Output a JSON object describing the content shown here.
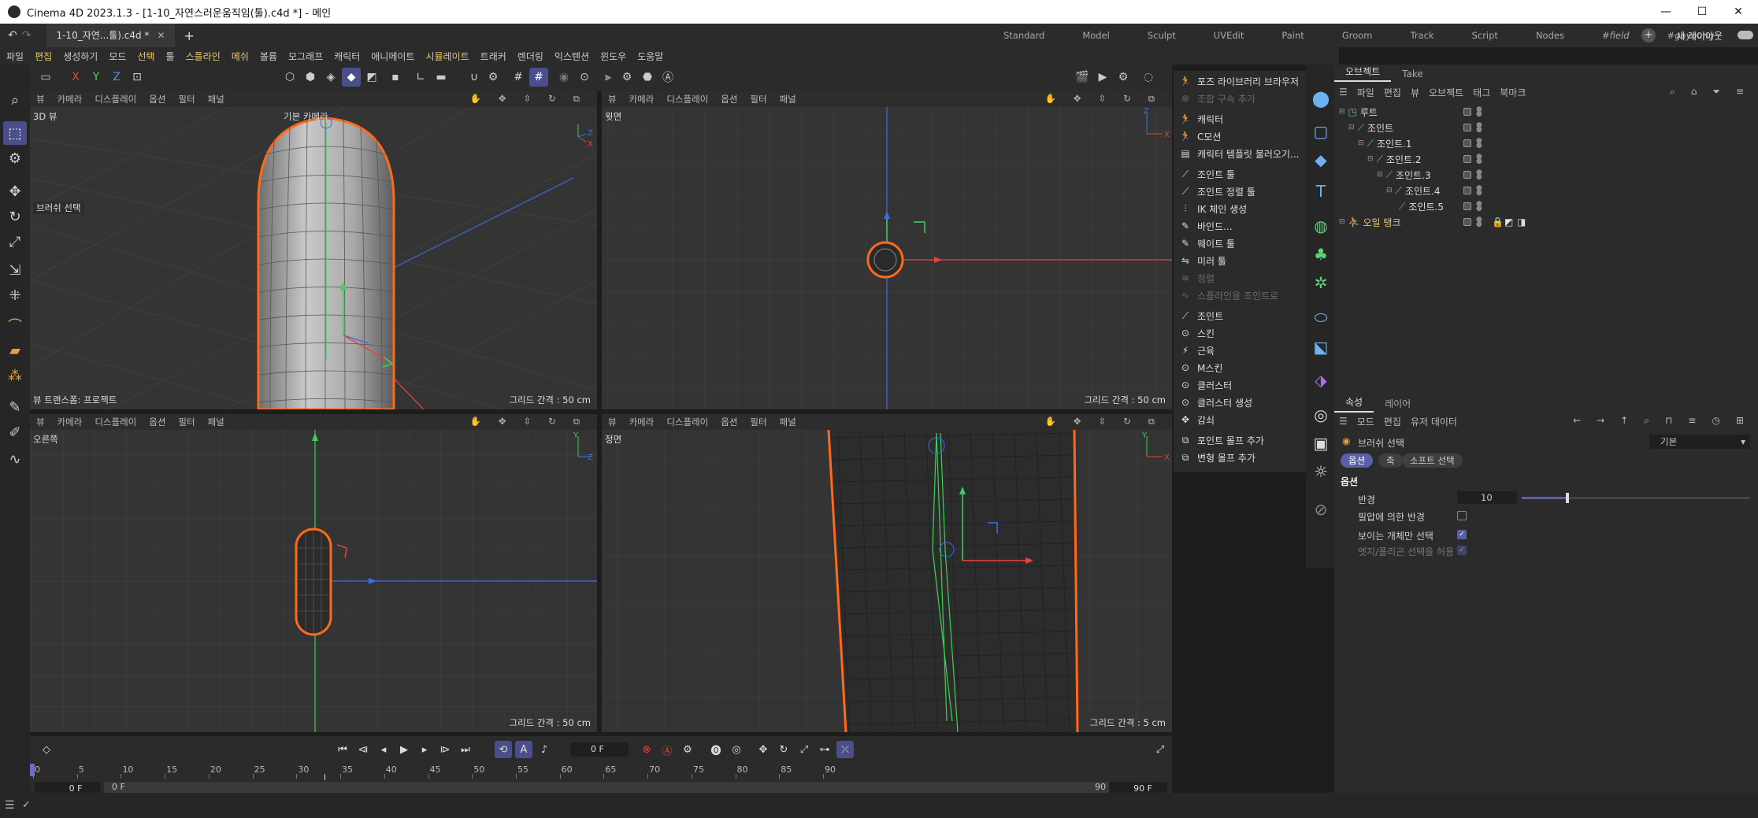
{
  "window": {
    "title": "Cinema 4D 2023.1.3 - [1-10_자연스러운움직임(툴).c4d *] - 메인",
    "minimize": "—",
    "maximize": "☐",
    "close": "✕"
  },
  "file_tab": {
    "label": "1-10_자연...툴).c4d *",
    "close": "✕",
    "add": "+"
  },
  "layouts": [
    "Standard",
    "Model",
    "Sculpt",
    "UVEdit",
    "Paint",
    "Groom",
    "Track",
    "Script",
    "Nodes",
    "#field",
    "#gayoung"
  ],
  "new_layout": "새 레이아웃",
  "menu": [
    "파일",
    "편집",
    "생성하기",
    "모드",
    "선택",
    "툴",
    "스플라인",
    "메쉬",
    "볼륨",
    "모그래프",
    "캐릭터",
    "애니메이트",
    "시뮬레이트",
    "트래커",
    "렌더링",
    "익스텐션",
    "윈도우",
    "도움말"
  ],
  "axis_buttons": [
    "X",
    "Y",
    "Z"
  ],
  "viewports": {
    "tl": {
      "menu": [
        "뷰",
        "카메라",
        "디스플레이",
        "옵션",
        "필터",
        "패널"
      ],
      "name": "3D 뷰",
      "camera": "기본 카메라",
      "grid": "그리드 간격 : 50 cm",
      "transform": "뷰 트랜스폼: 프로젝트",
      "tool_hint": "브러쉬 선택"
    },
    "tr": {
      "menu": [
        "뷰",
        "카메라",
        "디스플레이",
        "옵션",
        "필터",
        "패널"
      ],
      "name": "윗면",
      "grid": "그리드 간격 : 50 cm"
    },
    "bl": {
      "menu": [
        "뷰",
        "카메라",
        "디스플레이",
        "옵션",
        "필터",
        "패널"
      ],
      "name": "오른쪽",
      "grid": "그리드 간격 : 50 cm"
    },
    "br": {
      "menu": [
        "뷰",
        "카메라",
        "디스플레이",
        "옵션",
        "필터",
        "패널"
      ],
      "name": "정면",
      "grid": "그리드 간격 : 5 cm"
    }
  },
  "character_menu": [
    {
      "label": "포즈 라이브러리 브라우저",
      "dim": false
    },
    {
      "label": "조합 구속 추가",
      "dim": true
    },
    {
      "label": "캐릭터",
      "dim": false
    },
    {
      "label": "C모션",
      "dim": false
    },
    {
      "label": "캐릭터 템플릿 불러오기...",
      "dim": false
    },
    {
      "label": "조인트 툴",
      "dim": false
    },
    {
      "label": "조인트 정렬 툴",
      "dim": false
    },
    {
      "label": "IK 체인 생성",
      "dim": false
    },
    {
      "label": "바인드...",
      "dim": false
    },
    {
      "label": "웨이트 툴",
      "dim": false
    },
    {
      "label": "미러 툴",
      "dim": false
    },
    {
      "label": "정렬",
      "dim": true
    },
    {
      "label": "스플라인을 조인트로",
      "dim": true
    },
    {
      "label": "조인트",
      "dim": false
    },
    {
      "label": "스킨",
      "dim": false
    },
    {
      "label": "근육",
      "dim": false
    },
    {
      "label": "M스킨",
      "dim": false
    },
    {
      "label": "클러스터",
      "dim": false
    },
    {
      "label": "클러스터 생성",
      "dim": false
    },
    {
      "label": "감쇠",
      "dim": false
    },
    {
      "label": "포인트 몰프 추가",
      "dim": false
    },
    {
      "label": "변형 몰프 추가",
      "dim": false
    }
  ],
  "object_panel": {
    "tabs": [
      "오브젝트",
      "Take"
    ],
    "menu": [
      "파일",
      "편집",
      "뷰",
      "오브젝트",
      "태그",
      "북마크"
    ],
    "tree": [
      {
        "name": "루트",
        "depth": 0
      },
      {
        "name": "조인트",
        "depth": 1
      },
      {
        "name": "조인트.1",
        "depth": 2
      },
      {
        "name": "조인트.2",
        "depth": 3
      },
      {
        "name": "조인트.3",
        "depth": 4
      },
      {
        "name": "조인트.4",
        "depth": 5
      },
      {
        "name": "조인트.5",
        "depth": 6
      },
      {
        "name": "오일 탱크",
        "depth": 0
      }
    ]
  },
  "attributes": {
    "tabs": [
      "속성",
      "레이어"
    ],
    "menu": [
      "모드",
      "편집",
      "유저 데이터"
    ],
    "tool_name": "브러쉬 선택",
    "preset": "기본",
    "chips": [
      "옵션",
      "축",
      "소프트 선택"
    ],
    "section": "옵션",
    "radius_label": "반경",
    "radius_value": "10",
    "radius_fraction": 0.2,
    "options": [
      {
        "label": "필압에 의한 반경",
        "checked": false,
        "dim": false
      },
      {
        "label": "보이는 개체만 선택",
        "checked": true,
        "dim": false
      },
      {
        "label": "엣지/폴리곤 선택을 허용",
        "checked": true,
        "dim": true
      }
    ]
  },
  "timeline": {
    "current_frame": "0 F",
    "ticks": [
      "0",
      "5",
      "10",
      "15",
      "20",
      "25",
      "30",
      "35",
      "40",
      "45",
      "50",
      "55",
      "60",
      "65",
      "70",
      "75",
      "80",
      "85",
      "90"
    ],
    "start": "0 F",
    "range_start": "0 F",
    "range_end": "90 F",
    "end": "90 F"
  },
  "colors": {
    "accent": "#5a5fa8",
    "selection": "#ff6a1a",
    "axis_x": "#e8443a",
    "axis_y": "#3ed157",
    "axis_z": "#3a6ee8"
  }
}
